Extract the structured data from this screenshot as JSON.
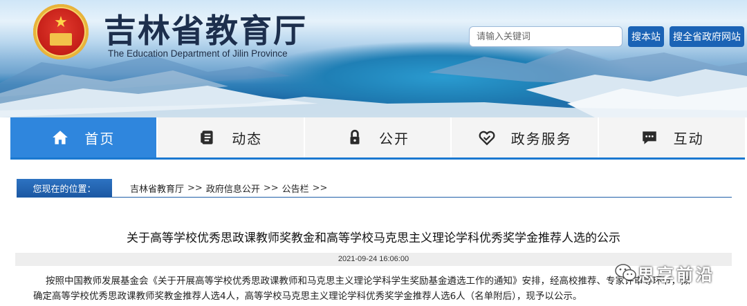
{
  "header": {
    "site_title": "吉林省教育厅",
    "site_subtitle": "The Education Department of Jilin Province",
    "search_placeholder": "请输入关键词",
    "search_button": "搜本站",
    "search_all_button": "搜全省政府网站"
  },
  "nav": {
    "items": [
      {
        "label": "首页",
        "icon": "home-icon"
      },
      {
        "label": "动态",
        "icon": "document-icon"
      },
      {
        "label": "公开",
        "icon": "lock-icon"
      },
      {
        "label": "政务服务",
        "icon": "handshake-heart-icon"
      },
      {
        "label": "互动",
        "icon": "chat-icon"
      }
    ],
    "active_index": 0
  },
  "breadcrumb": {
    "label": "您现在的位置：",
    "items": [
      "吉林省教育厅",
      "政府信息公开",
      "公告栏"
    ],
    "separator": ">>"
  },
  "article": {
    "title": "关于高等学校优秀思政课教师奖教金和高等学校马克思主义理论学科优秀奖学金推荐人选的公示",
    "date": "2021-09-24 16:06:00",
    "para1_line1": "按照中国教师发展基金会《关于开展高等学校优秀思政课教师和马克思主义理论学科学生奖励基金遴选工作的通知》安排，经高校推荐、专家评审等环节，拟",
    "para1_line2": "确定高等学校优秀思政课教师奖教金推荐人选4人，高等学校马克思主义理论学科优秀奖学金推荐人选6人（名单附后），现予以公示。"
  },
  "watermark": {
    "text": "思享前沿",
    "icon": "wechat-icon"
  },
  "colors": {
    "nav_active": "#2f86dd",
    "nav_underline": "#1a78d0",
    "button_blue": "#1b63b5",
    "title_dark": "#1d2f4d"
  }
}
